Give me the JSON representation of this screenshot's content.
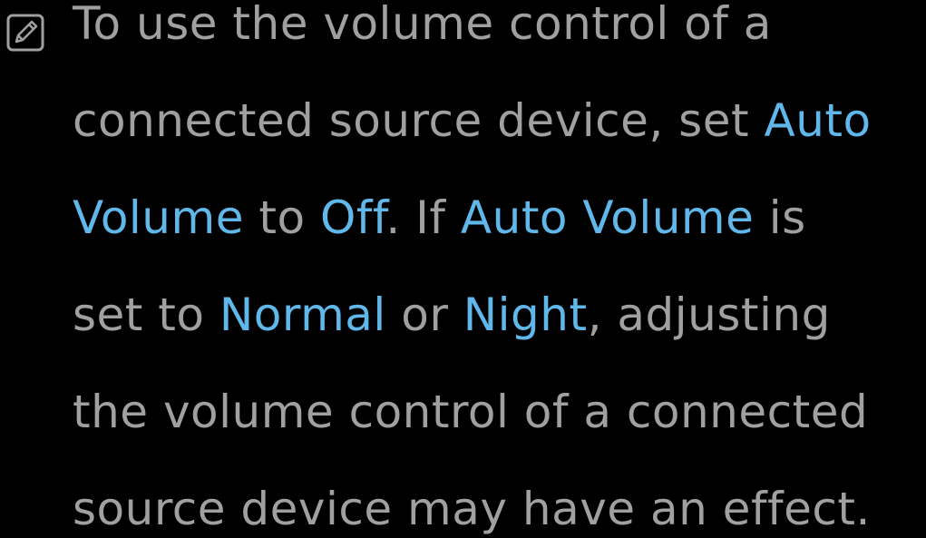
{
  "note": {
    "icon": "note-pencil-icon",
    "lines": [
      [
        {
          "text": "To use the volume control of a",
          "highlight": false
        }
      ],
      [
        {
          "text": "connected source device, set ",
          "highlight": false
        },
        {
          "text": "Auto",
          "highlight": true
        }
      ],
      [
        {
          "text": "Volume",
          "highlight": true
        },
        {
          "text": " to ",
          "highlight": false
        },
        {
          "text": "Off",
          "highlight": true
        },
        {
          "text": ". If ",
          "highlight": false
        },
        {
          "text": "Auto Volume",
          "highlight": true
        },
        {
          "text": " is",
          "highlight": false
        }
      ],
      [
        {
          "text": "set to ",
          "highlight": false
        },
        {
          "text": "Normal",
          "highlight": true
        },
        {
          "text": " or ",
          "highlight": false
        },
        {
          "text": "Night",
          "highlight": true
        },
        {
          "text": ", adjusting",
          "highlight": false
        }
      ],
      [
        {
          "text": "the volume control of a connected",
          "highlight": false
        }
      ],
      [
        {
          "text": "source device may have an effect.",
          "highlight": false
        }
      ]
    ]
  },
  "colors": {
    "background": "#000000",
    "text": "#a0a0a0",
    "highlight": "#5fb7ea",
    "icon": "#a0a0a0"
  }
}
